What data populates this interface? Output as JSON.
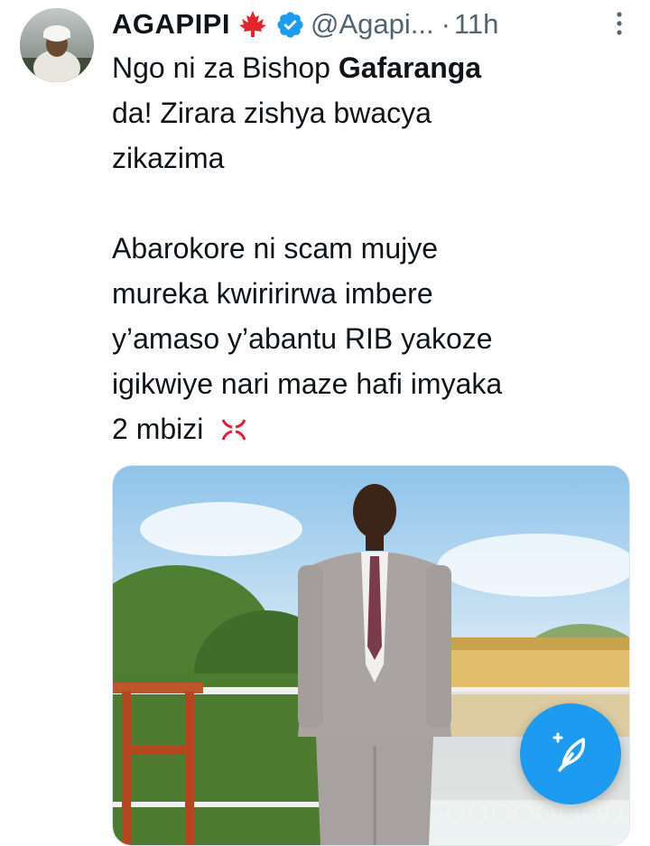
{
  "tweet": {
    "author_name": "AGAPIPI",
    "handle": "@Agapi...",
    "separator": "·",
    "time": "11h",
    "text": {
      "line1_pre": "Ngo ni za Bishop ",
      "line1_bold": "Gafaranga",
      "line2": "da! Zirara zishya  bwacya",
      "line3": "zikazima",
      "line4": "Abarokore ni scam mujye",
      "line5": "mureka kwiririrwa imbere",
      "line6": "y’amaso y’abantu RIB yakoze",
      "line7": "igikwiye nari maze hafi imyaka",
      "line8": "2 mbizi"
    },
    "emoji_icon": "angry-symbol-icon",
    "badge_icon": "maple-leaf-icon",
    "verified_icon": "verified-badge-icon"
  },
  "colors": {
    "accent": "#1d9bf0",
    "leaf": "#e0262a",
    "secondary_text": "#536471"
  },
  "compose_button": {
    "icon": "compose-feather-icon"
  }
}
